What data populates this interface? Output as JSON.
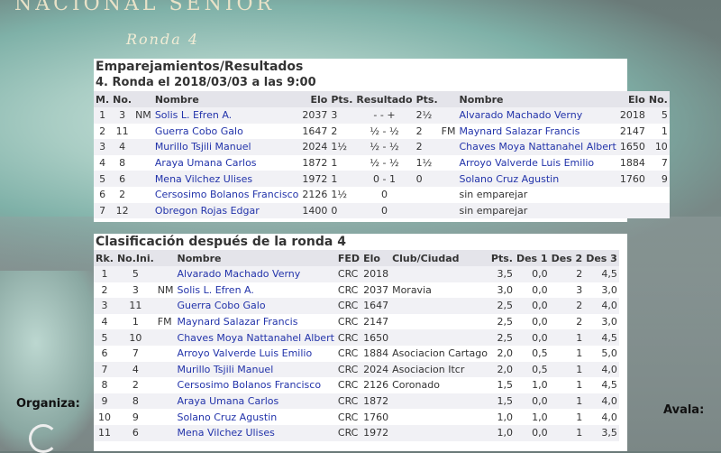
{
  "header": {
    "title": "NACIONAL SENIOR",
    "subtitle": "Ronda 4"
  },
  "footer": {
    "organiza": "Organiza:",
    "avala": "Avala:"
  },
  "pairings": {
    "title": "Emparejamientos/Resultados",
    "subtitle": "4. Ronda el 2018/03/03 a las 9:00",
    "headers": {
      "m": "M.",
      "no": "No.",
      "name": "Nombre",
      "elo": "Elo",
      "pts": "Pts.",
      "result": "Resultado",
      "pts2": "Pts.",
      "name2": "Nombre",
      "elo2": "Elo",
      "no2": "No."
    },
    "rows": [
      {
        "m": "1",
        "no": "3",
        "title": "NM",
        "name": "Solis L. Efren A.",
        "elo": "2037",
        "pts": "3",
        "result": "- - +",
        "pts2": "2½",
        "title2": "",
        "name2": "Alvarado Machado Verny",
        "elo2": "2018",
        "no2": "5"
      },
      {
        "m": "2",
        "no": "11",
        "title": "",
        "name": "Guerra Cobo Galo",
        "elo": "1647",
        "pts": "2",
        "result": "½ - ½",
        "pts2": "2",
        "title2": "FM",
        "name2": "Maynard Salazar Francis",
        "elo2": "2147",
        "no2": "1"
      },
      {
        "m": "3",
        "no": "4",
        "title": "",
        "name": "Murillo Tsjili Manuel",
        "elo": "2024",
        "pts": "1½",
        "result": "½ - ½",
        "pts2": "2",
        "title2": "",
        "name2": "Chaves Moya Nattanahel Albert",
        "elo2": "1650",
        "no2": "10"
      },
      {
        "m": "4",
        "no": "8",
        "title": "",
        "name": "Araya Umana Carlos",
        "elo": "1872",
        "pts": "1",
        "result": "½ - ½",
        "pts2": "1½",
        "title2": "",
        "name2": "Arroyo Valverde Luis Emilio",
        "elo2": "1884",
        "no2": "7"
      },
      {
        "m": "5",
        "no": "6",
        "title": "",
        "name": "Mena Vilchez Ulises",
        "elo": "1972",
        "pts": "1",
        "result": "0 - 1",
        "pts2": "0",
        "title2": "",
        "name2": "Solano Cruz Agustin",
        "elo2": "1760",
        "no2": "9"
      },
      {
        "m": "6",
        "no": "2",
        "title": "",
        "name": "Cersosimo Bolanos Francisco",
        "elo": "2126",
        "pts": "1½",
        "result": "0",
        "pts2": "",
        "title2": "",
        "name2": "sin emparejar",
        "elo2": "",
        "no2": ""
      },
      {
        "m": "7",
        "no": "12",
        "title": "",
        "name": "Obregon Rojas Edgar",
        "elo": "1400",
        "pts": "0",
        "result": "0",
        "pts2": "",
        "title2": "",
        "name2": "sin emparejar",
        "elo2": "",
        "no2": ""
      }
    ]
  },
  "standings": {
    "title": "Clasificación después de la ronda 4",
    "headers": {
      "rk": "Rk.",
      "noini": "No.Ini.",
      "title": "",
      "name": "Nombre",
      "fed": "FED",
      "elo": "Elo",
      "club": "Club/Ciudad",
      "pts": "Pts.",
      "des1": "Des 1",
      "des2": "Des 2",
      "des3": "Des 3"
    },
    "rows": [
      {
        "rk": "1",
        "noini": "5",
        "title": "",
        "name": "Alvarado Machado Verny",
        "fed": "CRC",
        "elo": "2018",
        "club": "",
        "pts": "3,5",
        "des1": "0,0",
        "des2": "2",
        "des3": "4,5"
      },
      {
        "rk": "2",
        "noini": "3",
        "title": "NM",
        "name": "Solis L. Efren A.",
        "fed": "CRC",
        "elo": "2037",
        "club": "Moravia",
        "pts": "3,0",
        "des1": "0,0",
        "des2": "3",
        "des3": "3,0"
      },
      {
        "rk": "3",
        "noini": "11",
        "title": "",
        "name": "Guerra Cobo Galo",
        "fed": "CRC",
        "elo": "1647",
        "club": "",
        "pts": "2,5",
        "des1": "0,0",
        "des2": "2",
        "des3": "4,0"
      },
      {
        "rk": "4",
        "noini": "1",
        "title": "FM",
        "name": "Maynard Salazar Francis",
        "fed": "CRC",
        "elo": "2147",
        "club": "",
        "pts": "2,5",
        "des1": "0,0",
        "des2": "2",
        "des3": "3,0"
      },
      {
        "rk": "5",
        "noini": "10",
        "title": "",
        "name": "Chaves Moya Nattanahel Albert",
        "fed": "CRC",
        "elo": "1650",
        "club": "",
        "pts": "2,5",
        "des1": "0,0",
        "des2": "1",
        "des3": "4,5"
      },
      {
        "rk": "6",
        "noini": "7",
        "title": "",
        "name": "Arroyo Valverde Luis Emilio",
        "fed": "CRC",
        "elo": "1884",
        "club": "Asociacion Cartago",
        "pts": "2,0",
        "des1": "0,5",
        "des2": "1",
        "des3": "5,0"
      },
      {
        "rk": "7",
        "noini": "4",
        "title": "",
        "name": "Murillo Tsjili Manuel",
        "fed": "CRC",
        "elo": "2024",
        "club": "Asociacion Itcr",
        "pts": "2,0",
        "des1": "0,5",
        "des2": "1",
        "des3": "4,0"
      },
      {
        "rk": "8",
        "noini": "2",
        "title": "",
        "name": "Cersosimo Bolanos Francisco",
        "fed": "CRC",
        "elo": "2126",
        "club": "Coronado",
        "pts": "1,5",
        "des1": "1,0",
        "des2": "1",
        "des3": "4,5"
      },
      {
        "rk": "9",
        "noini": "8",
        "title": "",
        "name": "Araya Umana Carlos",
        "fed": "CRC",
        "elo": "1872",
        "club": "",
        "pts": "1,5",
        "des1": "0,0",
        "des2": "1",
        "des3": "4,0"
      },
      {
        "rk": "10",
        "noini": "9",
        "title": "",
        "name": "Solano Cruz Agustin",
        "fed": "CRC",
        "elo": "1760",
        "club": "",
        "pts": "1,0",
        "des1": "1,0",
        "des2": "1",
        "des3": "4,0"
      },
      {
        "rk": "11",
        "noini": "6",
        "title": "",
        "name": "Mena Vilchez Ulises",
        "fed": "CRC",
        "elo": "1972",
        "club": "",
        "pts": "1,0",
        "des1": "0,0",
        "des2": "1",
        "des3": "3,5"
      }
    ]
  }
}
